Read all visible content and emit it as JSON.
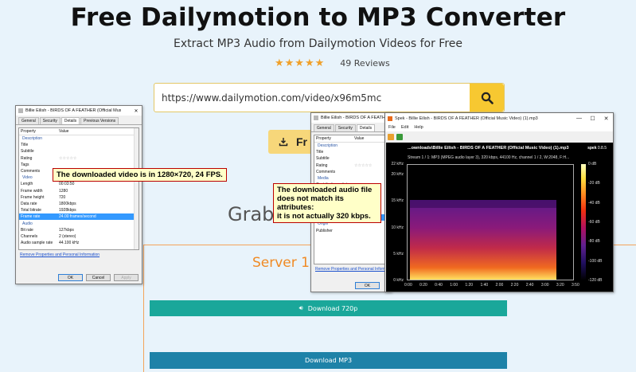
{
  "page": {
    "title": "Free Dailymotion to MP3 Converter",
    "subtitle": "Extract MP3 Audio from Dailymotion Videos for Free",
    "rating_stars": 5,
    "reviews": "49 Reviews",
    "accent_color": "#f7c831"
  },
  "search": {
    "value": "https://www.dailymotion.com/video/x96m5mc"
  },
  "convert_button": {
    "label": "Fr"
  },
  "grab_text": "Grab Me",
  "server_text": "Server 1",
  "downloads": {
    "dl720_label": "Download 720p",
    "mp3_label": "Download MP3"
  },
  "video_dialog": {
    "title": "Billie Eilish - BIRDS OF A FEATHER (Official Music Video)...",
    "tabs": [
      "General",
      "Security",
      "Details",
      "Previous Versions"
    ],
    "col_property": "Property",
    "col_value": "Value",
    "rows": [
      {
        "k": "Description",
        "v": "",
        "type": "section"
      },
      {
        "k": "Title",
        "v": ""
      },
      {
        "k": "Subtitle",
        "v": ""
      },
      {
        "k": "Rating",
        "v": "☆☆☆☆☆"
      },
      {
        "k": "Tags",
        "v": ""
      },
      {
        "k": "Comments",
        "v": ""
      },
      {
        "k": "Video",
        "v": "",
        "type": "section"
      },
      {
        "k": "Length",
        "v": "00:03:50"
      },
      {
        "k": "Frame width",
        "v": "1280"
      },
      {
        "k": "Frame height",
        "v": "720"
      },
      {
        "k": "Data rate",
        "v": "1800kbps"
      },
      {
        "k": "Total bitrate",
        "v": "1928kbps"
      },
      {
        "k": "Frame rate",
        "v": "24.00 frames/second",
        "type": "hl"
      },
      {
        "k": "Audio",
        "v": "",
        "type": "section"
      },
      {
        "k": "Bit rate",
        "v": "127kbps"
      },
      {
        "k": "Channels",
        "v": "2 (stereo)"
      },
      {
        "k": "Audio sample rate",
        "v": "44.100 kHz"
      }
    ],
    "link": "Remove Properties and Personal Information",
    "ok": "OK",
    "cancel": "Cancel",
    "apply": "Apply"
  },
  "audio_dialog": {
    "title": "Billie Eilish - BIRDS OF A FEATHER (Offici...",
    "tabs": [
      "General",
      "Security",
      "Details",
      "Previous Versions"
    ],
    "col_property": "Property",
    "col_value": "Value",
    "rows": [
      {
        "k": "Description",
        "v": "",
        "type": "section"
      },
      {
        "k": "Title",
        "v": ""
      },
      {
        "k": "Subtitle",
        "v": ""
      },
      {
        "k": "Rating",
        "v": "☆☆☆☆☆"
      },
      {
        "k": "Comments",
        "v": ""
      },
      {
        "k": "Media",
        "v": "",
        "type": "section"
      },
      {
        "k": "Contributing artists",
        "v": ""
      },
      {
        "k": "Year",
        "v": ""
      },
      {
        "k": "Genre",
        "v": ""
      },
      {
        "k": "Length",
        "v": "00:03:50"
      },
      {
        "k": "Audio",
        "v": "",
        "type": "section"
      },
      {
        "k": "Bit rate",
        "v": "320kbps",
        "type": "hl"
      },
      {
        "k": "Origin",
        "v": "",
        "type": "section"
      },
      {
        "k": "Publisher",
        "v": ""
      }
    ],
    "link": "Remove Properties and Personal Information",
    "ok": "OK"
  },
  "notes": {
    "video_note": "The downloaded video is in 1280×720, 24 FPS.",
    "audio_note_1": "The downloaded audio file",
    "audio_note_2": "does not match its attributes:",
    "audio_note_3": "it is not actually 320 kbps."
  },
  "spek": {
    "title": "Spek - Billie Eilish - BIRDS OF A FEATHER (Official Music Video) (1).mp3",
    "menu": [
      "File",
      "Edit",
      "Help"
    ],
    "filename": "...ownloads\\Billie Eilish - BIRDS OF A FEATHER (Official Music Video) (1).mp3",
    "app_name": "spek",
    "version": "0.8.5",
    "stream_info": "Stream 1 / 1: MP3 (MPEG audio layer 3), 320 kbps, 44100 Hz, channel 1 / 2, W:2048, F:H...",
    "y_labels": [
      "22 kHz",
      "20 kHz",
      "15 kHz",
      "10 kHz",
      "5 kHz",
      "0 kHz"
    ],
    "x_labels": [
      "0:00",
      "0:20",
      "0:40",
      "1:00",
      "1:20",
      "1:40",
      "2:00",
      "2:20",
      "2:40",
      "3:00",
      "3:20",
      "3:50"
    ],
    "db_labels": [
      "0 dB",
      "-20 dB",
      "-40 dB",
      "-60 dB",
      "-80 dB",
      "-100 dB",
      "-120 dB"
    ]
  }
}
